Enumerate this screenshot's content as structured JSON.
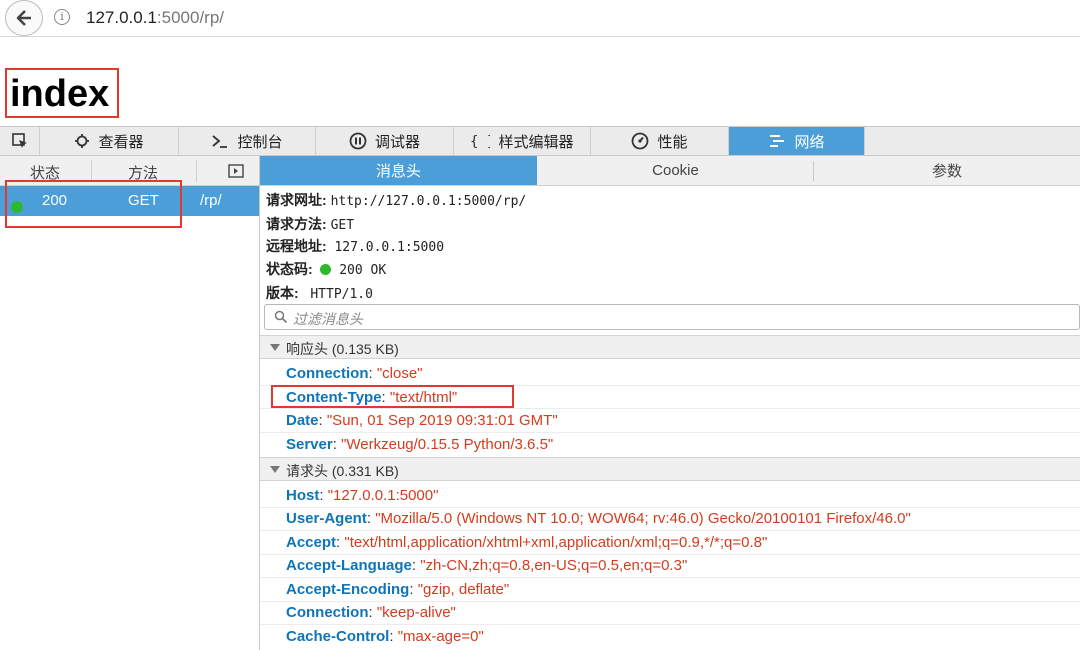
{
  "browser": {
    "url_host": "127.0.0.1",
    "url_path": ":5000/rp/"
  },
  "page": {
    "heading": "index"
  },
  "devtools": {
    "tabs": [
      {
        "label": "查看器",
        "icon": "inspector-icon"
      },
      {
        "label": "控制台",
        "icon": "console-icon"
      },
      {
        "label": "调试器",
        "icon": "debugger-icon"
      },
      {
        "label": "样式编辑器",
        "icon": "style-editor-icon"
      },
      {
        "label": "性能",
        "icon": "performance-icon"
      },
      {
        "label": "网络",
        "icon": "network-icon"
      }
    ],
    "active_tab": "网络",
    "accent_color": "#4c9ed9"
  },
  "request_list": {
    "columns": [
      "状态",
      "方法"
    ],
    "rows": [
      {
        "status": "200",
        "method": "GET",
        "file": "/rp/"
      }
    ]
  },
  "details": {
    "tabs": [
      "消息头",
      "Cookie",
      "参数"
    ],
    "active_tab": "消息头",
    "summary": {
      "url_label": "请求网址:",
      "url_value": "http://127.0.0.1:5000/rp/",
      "method_label": "请求方法:",
      "method_value": "GET",
      "remote_label": "远程地址:",
      "remote_value": "127.0.0.1:5000",
      "status_label": "状态码:",
      "status_value": "200 OK",
      "version_label": "版本:",
      "version_value": "HTTP/1.0"
    },
    "filter_placeholder": "过滤消息头",
    "response_section": "响应头 (0.135 KB)",
    "response_headers": [
      {
        "name": "Connection",
        "value": "\"close\""
      },
      {
        "name": "Content-Type",
        "value": "\"text/html\""
      },
      {
        "name": "Date",
        "value": "\"Sun, 01 Sep 2019 09:31:01 GMT\""
      },
      {
        "name": "Server",
        "value": "\"Werkzeug/0.15.5 Python/3.6.5\""
      }
    ],
    "request_section": "请求头 (0.331 KB)",
    "request_headers": [
      {
        "name": "Host",
        "value": "\"127.0.0.1:5000\""
      },
      {
        "name": "User-Agent",
        "value": "\"Mozilla/5.0 (Windows NT 10.0; WOW64; rv:46.0) Gecko/20100101 Firefox/46.0\""
      },
      {
        "name": "Accept",
        "value": "\"text/html,application/xhtml+xml,application/xml;q=0.9,*/*;q=0.8\""
      },
      {
        "name": "Accept-Language",
        "value": "\"zh-CN,zh;q=0.8,en-US;q=0.5,en;q=0.3\""
      },
      {
        "name": "Accept-Encoding",
        "value": "\"gzip, deflate\""
      },
      {
        "name": "Connection",
        "value": "\"keep-alive\""
      },
      {
        "name": "Cache-Control",
        "value": "\"max-age=0\""
      }
    ]
  },
  "colors": {
    "header_name": "#0f75b8",
    "header_value": "#d33c1e",
    "status_ok": "#2eb82e",
    "highlight_box": "#e0392f"
  }
}
